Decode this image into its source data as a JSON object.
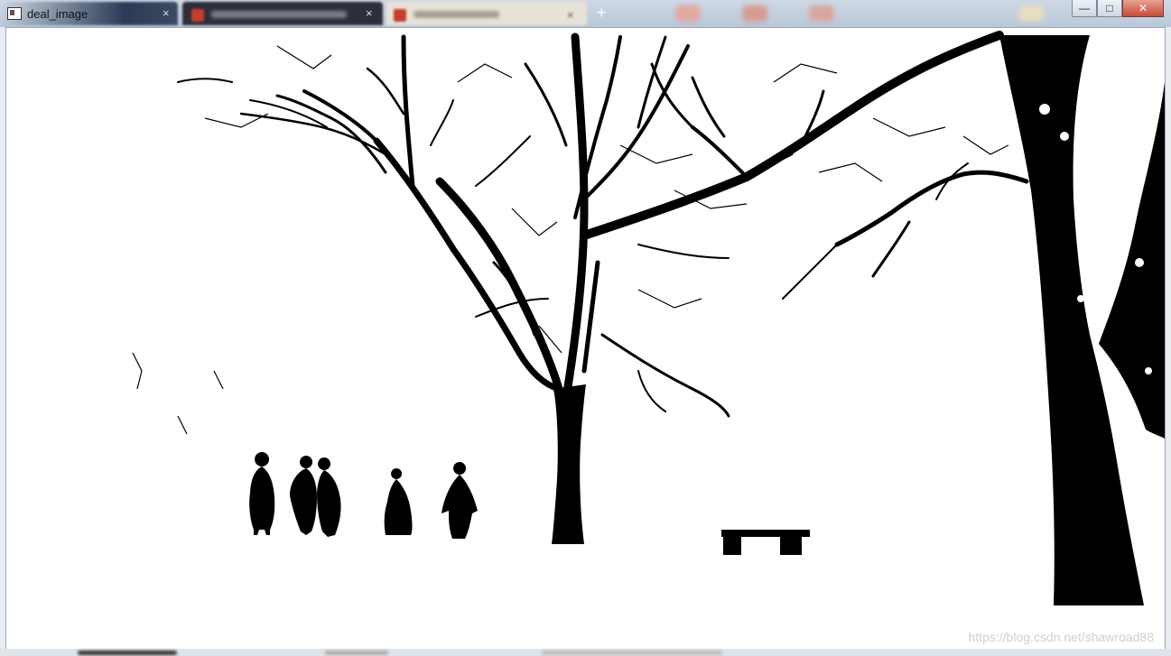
{
  "window": {
    "title": "deal_image",
    "buttons": {
      "minimize": "—",
      "maximize": "□",
      "close": "✕"
    }
  },
  "browser_tabs": [
    {
      "label": "",
      "close": "×"
    },
    {
      "label": "",
      "close": "×"
    },
    {
      "label": "",
      "close": "×"
    }
  ],
  "new_tab": "+",
  "image": {
    "description_icon": "binary-thresholded-winter-scene",
    "watermark": "https://blog.csdn.net/shawroad88"
  },
  "colors": {
    "foreground": "#000000",
    "background": "#ffffff",
    "close_button": "#c74c38"
  }
}
